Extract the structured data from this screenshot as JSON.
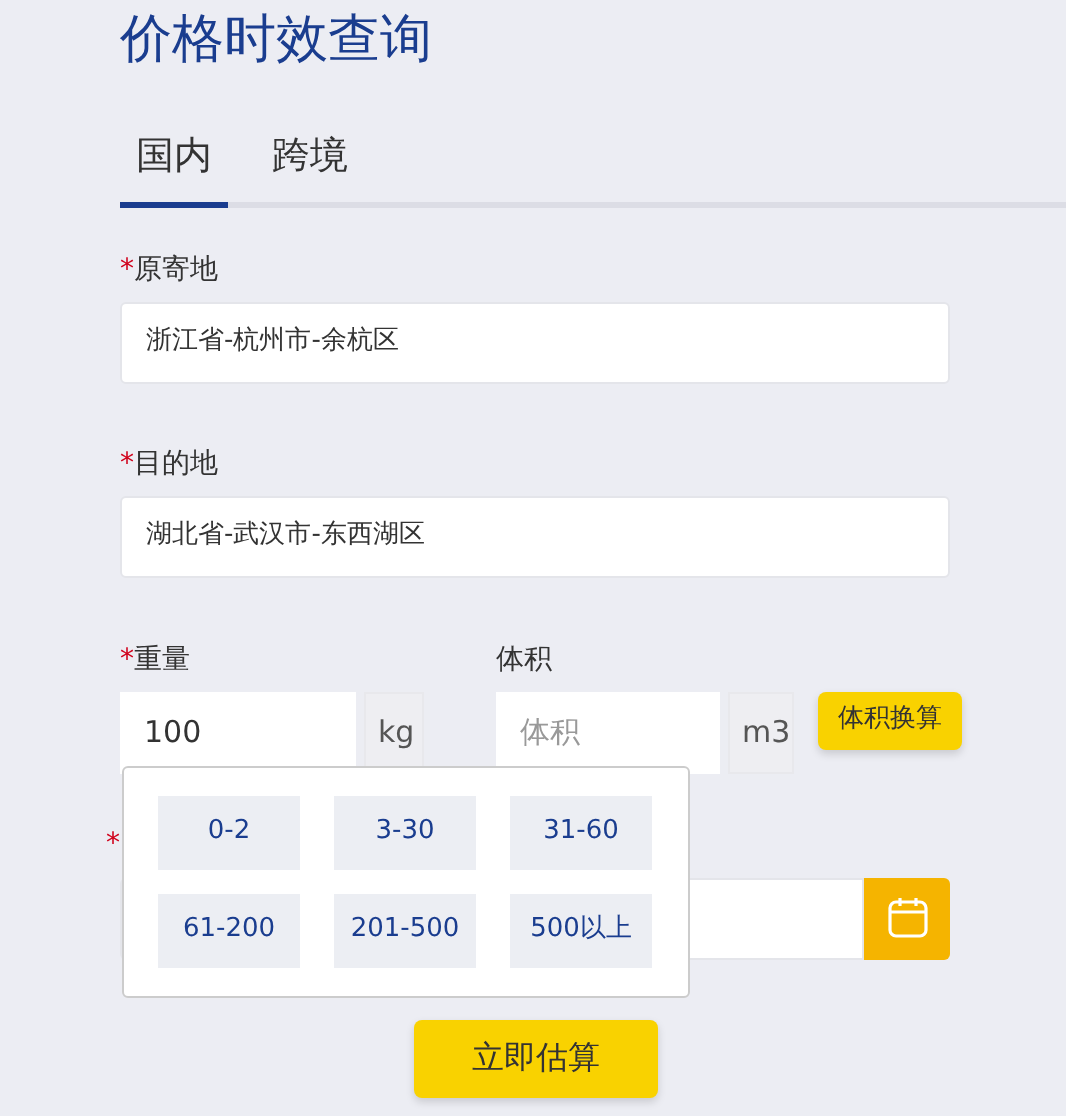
{
  "title": "价格时效查询",
  "tabs": [
    {
      "label": "国内",
      "selected": true
    },
    {
      "label": "跨境",
      "selected": false
    }
  ],
  "origin": {
    "mark": "*",
    "label": "原寄地",
    "value": "浙江省-杭州市-余杭区"
  },
  "destination": {
    "mark": "*",
    "label": "目的地",
    "value": "湖北省-武汉市-东西湖区"
  },
  "weight": {
    "mark": "*",
    "label": "重量",
    "value": "100",
    "unit": "kg"
  },
  "volume": {
    "label": "体积",
    "placeholder": "体积",
    "unit": "m3",
    "button": "体积换算"
  },
  "date": {
    "mark": "*"
  },
  "weight_options": [
    {
      "label": "0-2"
    },
    {
      "label": "3-30"
    },
    {
      "label": "31-60"
    },
    {
      "label": "61-200"
    },
    {
      "label": "201-500"
    },
    {
      "label": "500以上"
    }
  ],
  "submit": "立即估算"
}
